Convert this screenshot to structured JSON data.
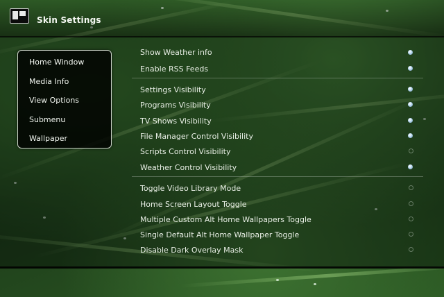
{
  "header": {
    "title": "Skin Settings",
    "icon": "skin-settings-icon"
  },
  "menu": {
    "items": [
      {
        "label": "Home Window"
      },
      {
        "label": "Media Info"
      },
      {
        "label": "View Options"
      },
      {
        "label": "Submenu"
      },
      {
        "label": "Wallpaper"
      }
    ]
  },
  "settings": {
    "groups": [
      [
        {
          "label": "Show Weather info",
          "enabled": true
        },
        {
          "label": "Enable RSS Feeds",
          "enabled": true
        }
      ],
      [
        {
          "label": "Settings Visibility",
          "enabled": true
        },
        {
          "label": "Programs Visibility",
          "enabled": true
        },
        {
          "label": "TV Shows Visibility",
          "enabled": true
        },
        {
          "label": "File Manager Control Visibility",
          "enabled": true
        },
        {
          "label": "Scripts Control Visibility",
          "enabled": false
        },
        {
          "label": "Weather Control Visibility",
          "enabled": true
        }
      ],
      [
        {
          "label": "Toggle Video Library Mode",
          "enabled": false
        },
        {
          "label": "Home Screen Layout Toggle",
          "enabled": false
        },
        {
          "label": "Multiple Custom Alt Home Wallpapers Toggle",
          "enabled": false
        },
        {
          "label": "Single Default Alt Home Wallpaper Toggle",
          "enabled": false
        },
        {
          "label": "Disable Dark Overlay Mask",
          "enabled": false
        }
      ]
    ]
  },
  "colors": {
    "toggle_on": "#b8d7ee",
    "panel_border": "#cfd7cc"
  }
}
